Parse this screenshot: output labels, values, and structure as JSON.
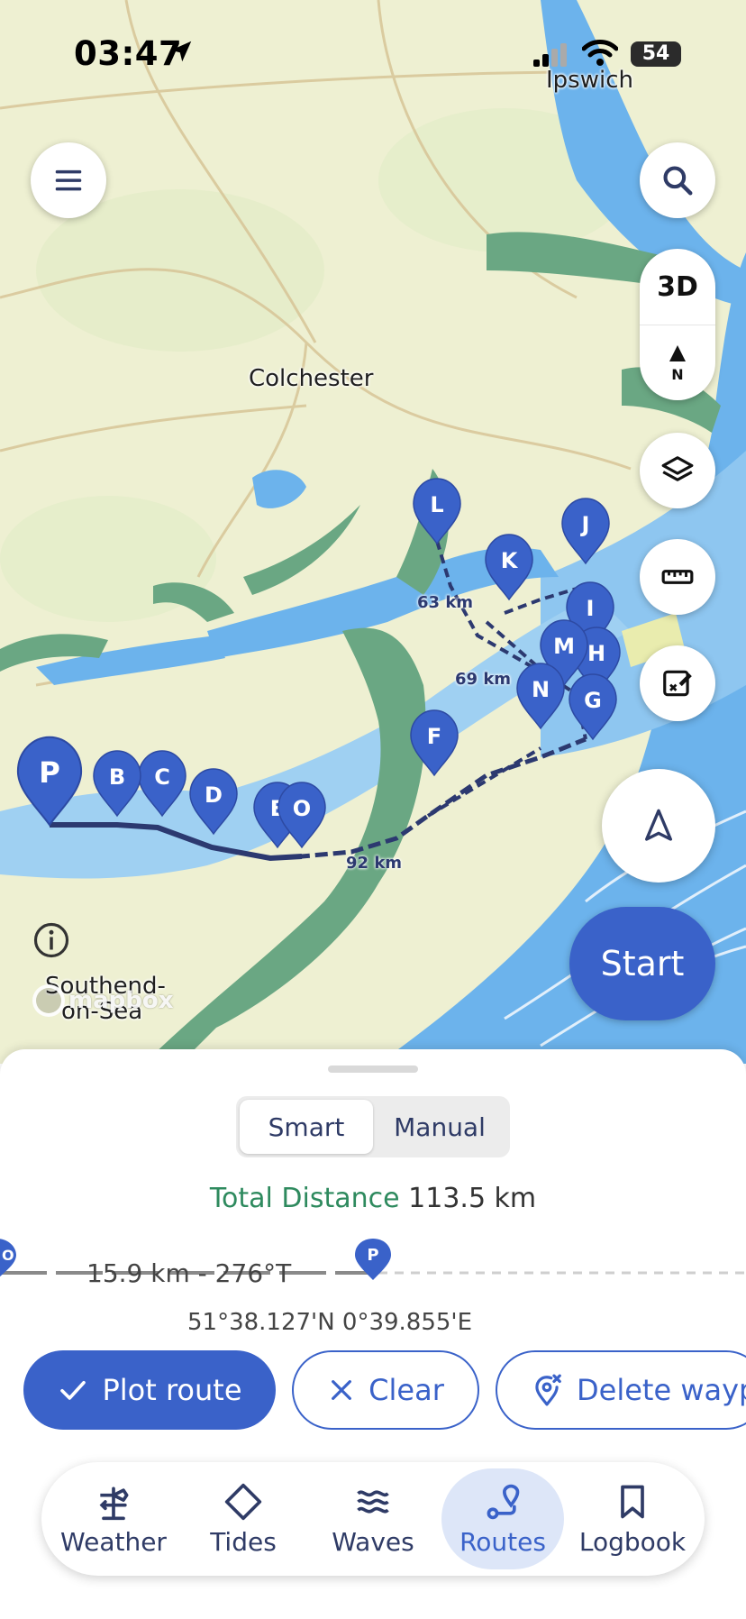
{
  "status_bar": {
    "time": "03:47",
    "battery": "54"
  },
  "map": {
    "places": {
      "ipswich": "Ipswich",
      "colchester": "Colchester",
      "southend_line1": "Southend-",
      "southend_line2": "on-Sea"
    },
    "distance_labels": [
      "63 km",
      "69 km",
      "92 km"
    ],
    "waypoints": [
      "P",
      "B",
      "C",
      "D",
      "E",
      "O",
      "F",
      "N",
      "G",
      "M",
      "H",
      "I",
      "J",
      "K",
      "L"
    ],
    "attribution": "mapbox",
    "controls": {
      "three_d": "3D",
      "north": "N",
      "start": "Start"
    }
  },
  "sheet": {
    "mode_options": [
      "Smart",
      "Manual"
    ],
    "active_mode": "Smart",
    "total_distance_label": "Total Distance",
    "total_distance_value": "113.5 km",
    "leg_from": "O",
    "leg_to": "P",
    "leg_text": "15.9 km - 276°T",
    "coordinates": "51°38.127'N  0°39.855'E",
    "buttons": {
      "plot": "Plot route",
      "clear": "Clear",
      "delete": "Delete waypoint"
    }
  },
  "tabs": [
    {
      "label": "Weather",
      "icon": "weather-vane-icon",
      "active": false
    },
    {
      "label": "Tides",
      "icon": "diamond-icon",
      "active": false
    },
    {
      "label": "Waves",
      "icon": "waves-icon",
      "active": false
    },
    {
      "label": "Routes",
      "icon": "route-icon",
      "active": true
    },
    {
      "label": "Logbook",
      "icon": "bookmark-icon",
      "active": false
    }
  ],
  "colors": {
    "accent": "#3a62c9",
    "land": "#eef0d0",
    "marsh": "#6aa783",
    "water": "#6cb3ec",
    "route": "#2c3970",
    "total_label": "#2e8a5e"
  }
}
